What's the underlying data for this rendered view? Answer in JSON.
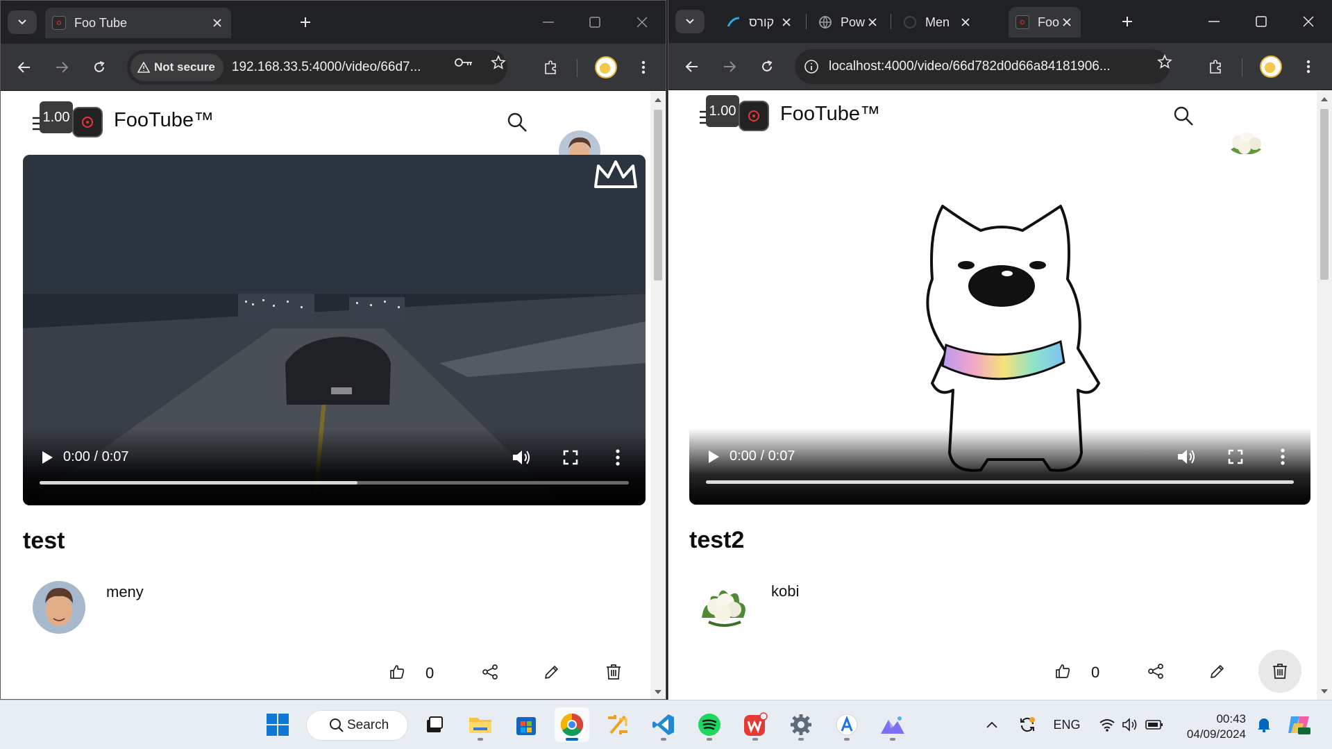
{
  "left_window": {
    "tab_title": "Foo Tube",
    "security_label": "Not secure",
    "url": "192.168.33.5:4000/video/66d7...",
    "page": {
      "speed": "1.00",
      "brand": "FooTube™",
      "video": {
        "time": "0:00 / 0:07",
        "buffered_fraction": 0.54
      },
      "video_title": "test",
      "uploader": "meny",
      "like_count": "0"
    }
  },
  "right_window": {
    "tabs": [
      {
        "title": "קורס"
      },
      {
        "title": "Pow"
      },
      {
        "title": "Men"
      },
      {
        "title": "Foo"
      }
    ],
    "url": "localhost:4000/video/66d782d0d66a84181906...",
    "page": {
      "speed": "1.00",
      "brand": "FooTube™",
      "video": {
        "time": "0:00 / 0:07",
        "buffered_fraction": 1.0
      },
      "video_title": "test2",
      "uploader": "kobi",
      "like_count": "0"
    }
  },
  "taskbar": {
    "search_label": "Search",
    "language": "ENG",
    "time": "00:43",
    "date": "04/09/2024",
    "apps": [
      "windows-start",
      "search",
      "task-view",
      "file-explorer",
      "microsoft-store",
      "chrome",
      "app-tool",
      "vscode",
      "spotify",
      "wps-office",
      "settings",
      "app-a",
      "app-mountains"
    ]
  },
  "colors": {
    "tabstrip": "#202124",
    "toolbar": "#35363a",
    "taskbar": "#e8edf4",
    "accent": "#0067c0"
  }
}
